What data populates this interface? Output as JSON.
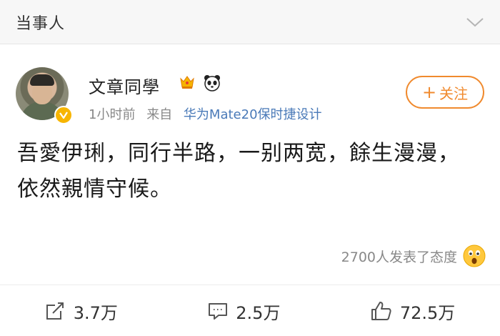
{
  "header": {
    "title": "当事人"
  },
  "post": {
    "username": "文章同學",
    "time": "1小时前",
    "from_label": "来自",
    "device": "华为Mate20保时捷设计",
    "follow_label": "关注",
    "text": "吾愛伊琍，同行半路，一别两宽，餘生漫漫，依然親情守候。",
    "reactions_text": "2700人发表了态度"
  },
  "actions": {
    "repost": "3.7万",
    "comment": "2.5万",
    "like": "72.5万"
  },
  "colors": {
    "accent_orange": "#f08a2e",
    "link_blue": "#4a7ab8",
    "verified_gold": "#f7b500"
  },
  "icons": [
    "chevron-down-icon",
    "crown-badge-icon",
    "panda-badge-icon",
    "verified-badge-icon",
    "surprised-face-icon",
    "repost-icon",
    "comment-icon",
    "like-icon"
  ]
}
